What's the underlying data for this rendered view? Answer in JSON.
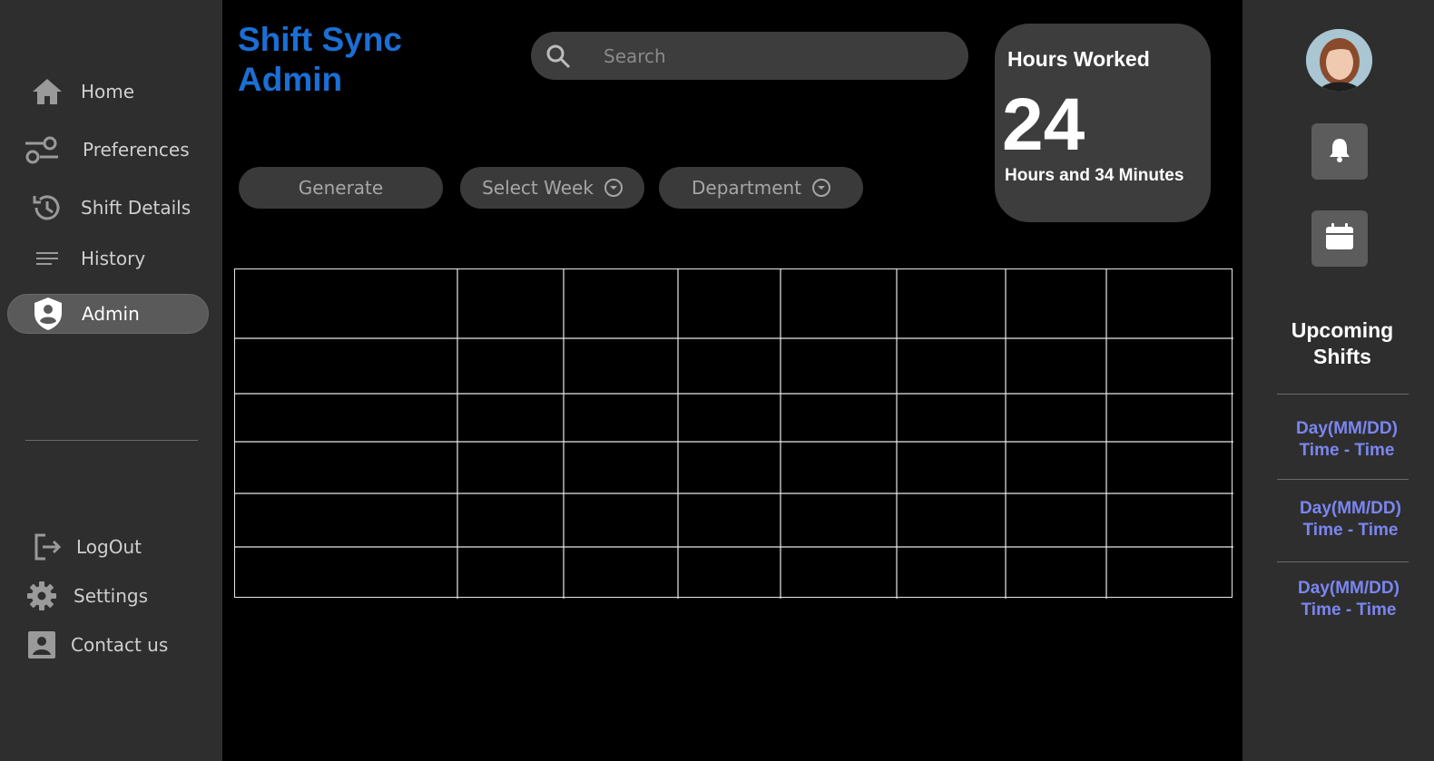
{
  "app": {
    "title": "Shift Sync Admin"
  },
  "sidebar": {
    "items": [
      {
        "label": "Home",
        "icon": "home-icon"
      },
      {
        "label": "Preferences",
        "icon": "sliders-icon"
      },
      {
        "label": "Shift Details",
        "icon": "history-clock-icon"
      },
      {
        "label": "History",
        "icon": "lines-icon"
      },
      {
        "label": "Admin",
        "icon": "shield-user-icon",
        "active": true
      }
    ],
    "bottom_items": [
      {
        "label": "LogOut",
        "icon": "logout-icon"
      },
      {
        "label": "Settings",
        "icon": "gear-icon"
      },
      {
        "label": "Contact us",
        "icon": "contact-card-icon"
      }
    ]
  },
  "search": {
    "placeholder": "Search",
    "value": ""
  },
  "toolbar": {
    "generate_label": "Generate",
    "select_week_label": "Select Week",
    "department_label": "Department"
  },
  "hours_card": {
    "title": "Hours Worked",
    "hours": "24",
    "subtitle": "Hours and 34 Minutes"
  },
  "schedule_grid": {
    "columns": 8,
    "rows": 6
  },
  "upcoming": {
    "title": "Upcoming Shifts",
    "shifts": [
      {
        "day": "Day(MM/DD)",
        "time": "Time - Time"
      },
      {
        "day": "Day(MM/DD)",
        "time": "Time - Time"
      },
      {
        "day": "Day(MM/DD)",
        "time": "Time - Time"
      }
    ]
  },
  "colors": {
    "accent_title": "#1b6fd4",
    "shift_text": "#7b86f0",
    "panel_bg": "#2e2e2e",
    "background": "#000000"
  }
}
